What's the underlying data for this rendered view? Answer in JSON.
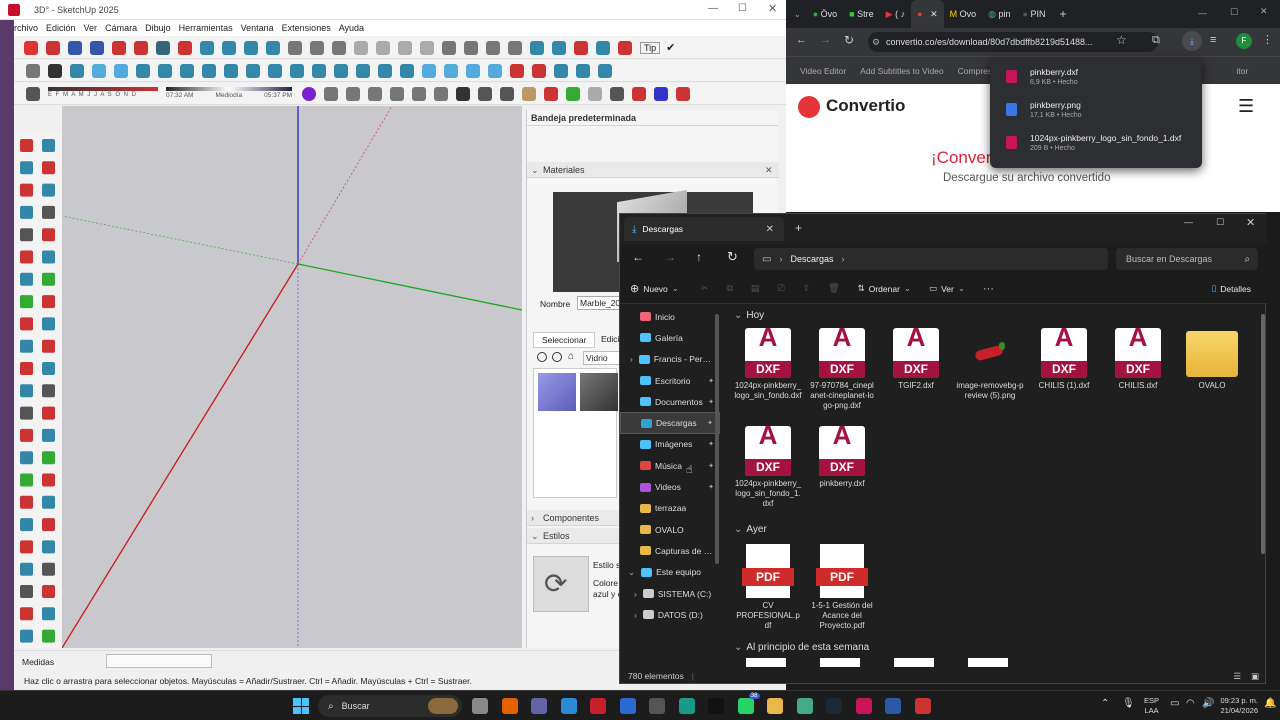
{
  "sketchup": {
    "title": "3D° - SketchUp 2025",
    "menu": [
      "Archivo",
      "Edición",
      "Ver",
      "Cámara",
      "Dibujo",
      "Herramientas",
      "Ventana",
      "Extensiones",
      "Ayuda"
    ],
    "shadow_months": "E F M A M J J A S O N D",
    "time_start": "07:32 AM",
    "time_mid": "Mediodía",
    "time_end": "05:37 PM",
    "tips_label": "Tip",
    "tray_title": "Bandeja predeterminada",
    "materials_title": "Materiales",
    "name_label": "Nombre",
    "name_value": "Marble_20",
    "tab_select": "Seleccionar",
    "tab_edit": "Edici",
    "material_dropdown": "Vidrio",
    "components_title": "Componentes",
    "styles_title": "Estilos",
    "style_name": "Estilo s",
    "style_desc": "Colore azul y c",
    "measures_label": "Medidas",
    "status_text": "Haz clic o arrastra para seleccionar objetos. Mayúsculas = Añadir/Sustraer. Ctrl = Añadir. Mayúsculas + Ctrl = Sustraer."
  },
  "chrome": {
    "tabs": [
      "Övo",
      "Stre",
      "(",
      "",
      "Ovo",
      "pin",
      "PIN"
    ],
    "url": "convertio.co/es/download/80d7dbdffb8219d51488...",
    "profile": "F",
    "bookmarks": [
      "Video Editor",
      "Add Subtitles to Video",
      "Compress",
      "itor"
    ],
    "logo_text": "Convertio",
    "heading": "¡Conver",
    "subheading": "Descargue su archivo convertido",
    "downloads": [
      {
        "name": "pinkberry.dxf",
        "meta": "6,9 KB • Hecho",
        "color": "#c8155a"
      },
      {
        "name": "pinkberry.png",
        "meta": "17,1 KB • Hecho",
        "color": "#3b78e7"
      },
      {
        "name": "1024px-pinkberry_logo_sin_fondo_1.dxf",
        "meta": "209 B • Hecho",
        "color": "#c8155a"
      }
    ]
  },
  "explorer": {
    "tab_title": "Descargas",
    "breadcrumb": "Descargas",
    "search_placeholder": "Buscar en Descargas",
    "cmd_new": "Nuevo",
    "cmd_sort": "Ordenar",
    "cmd_view": "Ver",
    "cmd_details": "Detalles",
    "sidebar": [
      "Inicio",
      "Galería",
      "Francis - Person",
      "Escritorio",
      "Documentos",
      "Descargas",
      "Imágenes",
      "Música",
      "Videos",
      "terrazaa",
      "OVALO",
      "Capturas de par",
      "Este equipo",
      "SISTEMA (C:)",
      "DATOS (D:)"
    ],
    "group_today": "Hoy",
    "group_yesterday": "Ayer",
    "group_week": "Al principio de esta semana",
    "files_today": [
      {
        "label": "1024px-pinkberry_logo_sin_fondo.dxf",
        "type": "dxf"
      },
      {
        "label": "97-970784_cineplanet-cineplanet-logo-png.dxf",
        "type": "dxf"
      },
      {
        "label": "TGIF2.dxf",
        "type": "dxf"
      },
      {
        "label": "image-removebg-preview (5).png",
        "type": "png"
      },
      {
        "label": "CHILIS (1).dxf",
        "type": "dxf"
      },
      {
        "label": "CHILIS.dxf",
        "type": "dxf"
      },
      {
        "label": "OVALO",
        "type": "folder"
      },
      {
        "label": "1024px-pinkberry_logo_sin_fondo_1.dxf",
        "type": "dxf"
      },
      {
        "label": "pinkberry.dxf",
        "type": "dxf"
      }
    ],
    "files_yesterday": [
      {
        "label": "CV PROFESIONAL.pdf"
      },
      {
        "label": "1-5-1 Gestión del Acance del Proyecto.pdf"
      }
    ],
    "icon_dxf_letter": "A",
    "icon_dxf_badge": "DXF",
    "icon_pdf_badge": "PDF",
    "item_count": "780 elementos"
  },
  "taskbar": {
    "search": "Buscar",
    "lang": "ESP",
    "lang2": "LAA",
    "time": "09:23 p. m.",
    "date": "21/04/2026",
    "whatsapp_badge": "38"
  }
}
